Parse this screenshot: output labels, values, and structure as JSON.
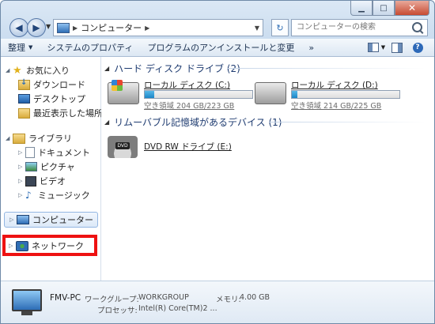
{
  "address": {
    "path": "コンピューター"
  },
  "search": {
    "placeholder": "コンピューターの検索"
  },
  "toolbar": {
    "organize": "整理",
    "system_properties": "システムのプロパティ",
    "uninstall": "プログラムのアンインストールと変更",
    "more": "»"
  },
  "nav": {
    "favorites": "お気に入り",
    "downloads": "ダウンロード",
    "desktop": "デスクトップ",
    "recent": "最近表示した場所",
    "libraries": "ライブラリ",
    "documents": "ドキュメント",
    "pictures": "ピクチャ",
    "videos": "ビデオ",
    "music": "ミュージック",
    "computer": "コンピューター",
    "network": "ネットワーク"
  },
  "groups": {
    "hdd_header": "ハード ディスク ドライブ (2)",
    "removable_header": "リムーバブル記憶域があるデバイス (1)"
  },
  "drives": {
    "c": {
      "name": "ローカル ディスク (C:)",
      "free": "空き領域 204 GB/223 GB",
      "used_fraction": 0.085
    },
    "d": {
      "name": "ローカル ディスク (D:)",
      "free": "空き領域 214 GB/225 GB",
      "used_fraction": 0.05
    },
    "dvd": {
      "name": "DVD RW ドライブ (E:)",
      "label": "DVD"
    }
  },
  "details": {
    "pc_name": "FMV-PC",
    "workgroup_label": "ワークグループ:",
    "workgroup_value": "WORKGROUP",
    "memory_label": "メモリ:",
    "memory_value": "4.00 GB",
    "processor_label": "プロセッサ:",
    "processor_value": "Intel(R) Core(TM)2 ..."
  },
  "colors": {
    "highlight": "#ee1111",
    "bar_fill": "#1b86c7"
  }
}
